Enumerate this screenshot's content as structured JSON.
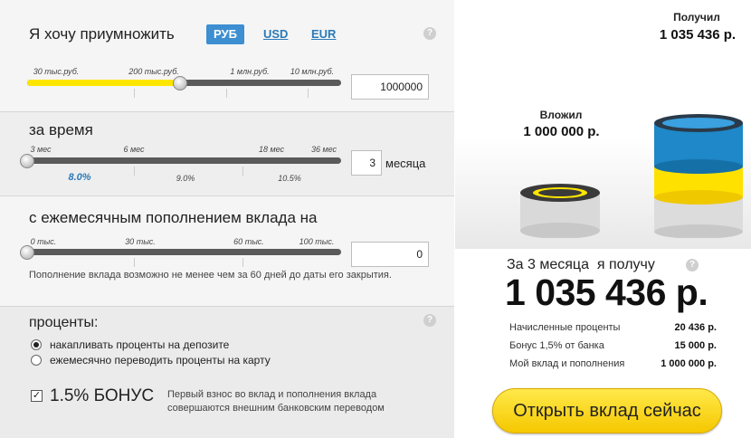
{
  "amount": {
    "heading": "Я хочу приумножить",
    "currencies": [
      "РУБ",
      "USD",
      "EUR"
    ],
    "active_currency": "РУБ",
    "ticks": [
      "30 тыс.руб.",
      "200 тыс.руб.",
      "1 млн.руб.",
      "10 млн.руб."
    ],
    "value": "1000000",
    "slider_fraction": 0.75
  },
  "term": {
    "heading": "за время",
    "ticks": [
      "3 мес",
      "6 мес",
      "18 мес",
      "36 мес"
    ],
    "value": "3",
    "unit": "месяца",
    "rates": [
      "8.0%",
      "9.0%",
      "10.5%"
    ],
    "slider_fraction": 0.0
  },
  "topup": {
    "heading": "с ежемесячным пополнением вклада на",
    "ticks": [
      "0 тыс.",
      "30 тыс.",
      "60 тыс.",
      "100 тыс."
    ],
    "value": "0",
    "note": "Пополнение вклада возможно не менее чем за 60 дней до даты его закрытия.",
    "slider_fraction": 0.0
  },
  "interest": {
    "heading": "проценты:",
    "options": [
      "накапливать проценты на депозите",
      "ежемесячно переводить проценты на карту"
    ],
    "selected_index": 0,
    "bonus_label": "1.5% БОНУС",
    "bonus_checked": true,
    "bonus_note_1": "Первый взнос во вклад и пополнения вклада",
    "bonus_note_2": "совершаются внешним банковским переводом"
  },
  "help_icon": "?",
  "visual": {
    "got_label": "Получил",
    "got_value": "1 035 436 р.",
    "invested_label": "Вложил",
    "invested_value": "1 000 000 р."
  },
  "result": {
    "title": "За 3 месяца  я получу",
    "total": "1 035 436 р.",
    "rows": [
      {
        "label": "Начисленные проценты",
        "value": "20 436 р."
      },
      {
        "label": "Бонус 1,5% от банка",
        "value": "15 000 р."
      },
      {
        "label": "Мой вклад и пополнения",
        "value": "1 000 000 р."
      }
    ],
    "cta": "Открыть вклад сейчас"
  },
  "colors": {
    "accent": "#3d8fd1",
    "slider_fill": "#ffe600",
    "button": "#f5c800",
    "blue_cylinder": "#1e88c8"
  }
}
